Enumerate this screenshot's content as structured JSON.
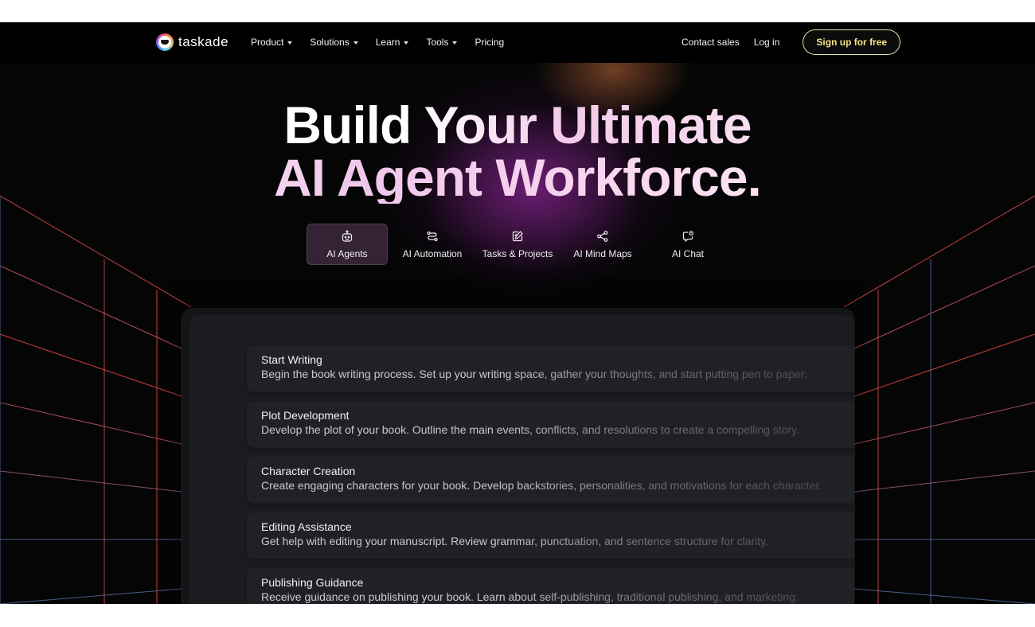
{
  "brand": {
    "name": "taskade"
  },
  "nav": {
    "menu": [
      {
        "label": "Product",
        "dropdown": true
      },
      {
        "label": "Solutions",
        "dropdown": true
      },
      {
        "label": "Learn",
        "dropdown": true
      },
      {
        "label": "Tools",
        "dropdown": true
      },
      {
        "label": "Pricing",
        "dropdown": false
      }
    ],
    "contact": "Contact sales",
    "login": "Log in",
    "signup": "Sign up for free"
  },
  "hero": {
    "line1": "Build Your Ultimate",
    "line2": "AI Agent Workforce."
  },
  "tabs": [
    {
      "label": "AI Agents",
      "icon": "robot-icon",
      "active": true
    },
    {
      "label": "AI Automation",
      "icon": "automation-icon",
      "active": false
    },
    {
      "label": "Tasks & Projects",
      "icon": "edit-task-icon",
      "active": false
    },
    {
      "label": "AI Mind Maps",
      "icon": "share-nodes-icon",
      "active": false
    },
    {
      "label": "AI Chat",
      "icon": "chat-icon",
      "active": false
    }
  ],
  "cards": [
    {
      "title": "Start Writing",
      "desc": "Begin the book writing process. Set up your writing space, gather your thoughts, and start putting pen to paper."
    },
    {
      "title": "Plot Development",
      "desc": "Develop the plot of your book. Outline the main events, conflicts, and resolutions to create a compelling story."
    },
    {
      "title": "Character Creation",
      "desc": "Create engaging characters for your book. Develop backstories, personalities, and motivations for each character."
    },
    {
      "title": "Editing Assistance",
      "desc": "Get help with editing your manuscript. Review grammar, punctuation, and sentence structure for clarity."
    },
    {
      "title": "Publishing Guidance",
      "desc": "Receive guidance on publishing your book. Learn about self-publishing, traditional publishing, and marketing."
    }
  ],
  "colors": {
    "background": "#050506",
    "signup_text": "#f6e58a",
    "grid_red": "#c8403c",
    "grid_blue": "#4a5f86"
  }
}
